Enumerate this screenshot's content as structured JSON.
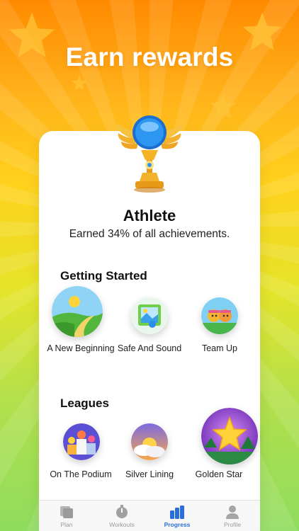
{
  "headline": "Earn rewards",
  "achievement": {
    "title": "Athlete",
    "subtitle": "Earned 34% of all achievements."
  },
  "sections": [
    {
      "title": "Getting Started",
      "badges": [
        {
          "label": "A New Beginning",
          "icon": "sunrise-path-icon"
        },
        {
          "label": "Safe And Sound",
          "icon": "photo-frame-icon"
        },
        {
          "label": "Team Up",
          "icon": "team-faces-icon"
        }
      ]
    },
    {
      "title": "Leagues",
      "badges": [
        {
          "label": "On The Podium",
          "icon": "podium-icon"
        },
        {
          "label": "Silver Lining",
          "icon": "cloud-sunset-icon"
        },
        {
          "label": "Golden Star",
          "icon": "golden-star-icon"
        }
      ]
    }
  ],
  "tabbar": {
    "tabs": [
      {
        "label": "Plan",
        "icon": "cards-icon"
      },
      {
        "label": "Workouts",
        "icon": "stopwatch-icon"
      },
      {
        "label": "Progress",
        "icon": "bar-chart-icon"
      },
      {
        "label": "Profile",
        "icon": "person-icon"
      }
    ],
    "active": "Progress"
  },
  "colors": {
    "background_top": "#ff8a00",
    "background_bottom": "#8fdc5e",
    "accent": "#2a6fd8",
    "trophy_gold": "#f5b325",
    "trophy_orb": "#1e8ef0"
  }
}
